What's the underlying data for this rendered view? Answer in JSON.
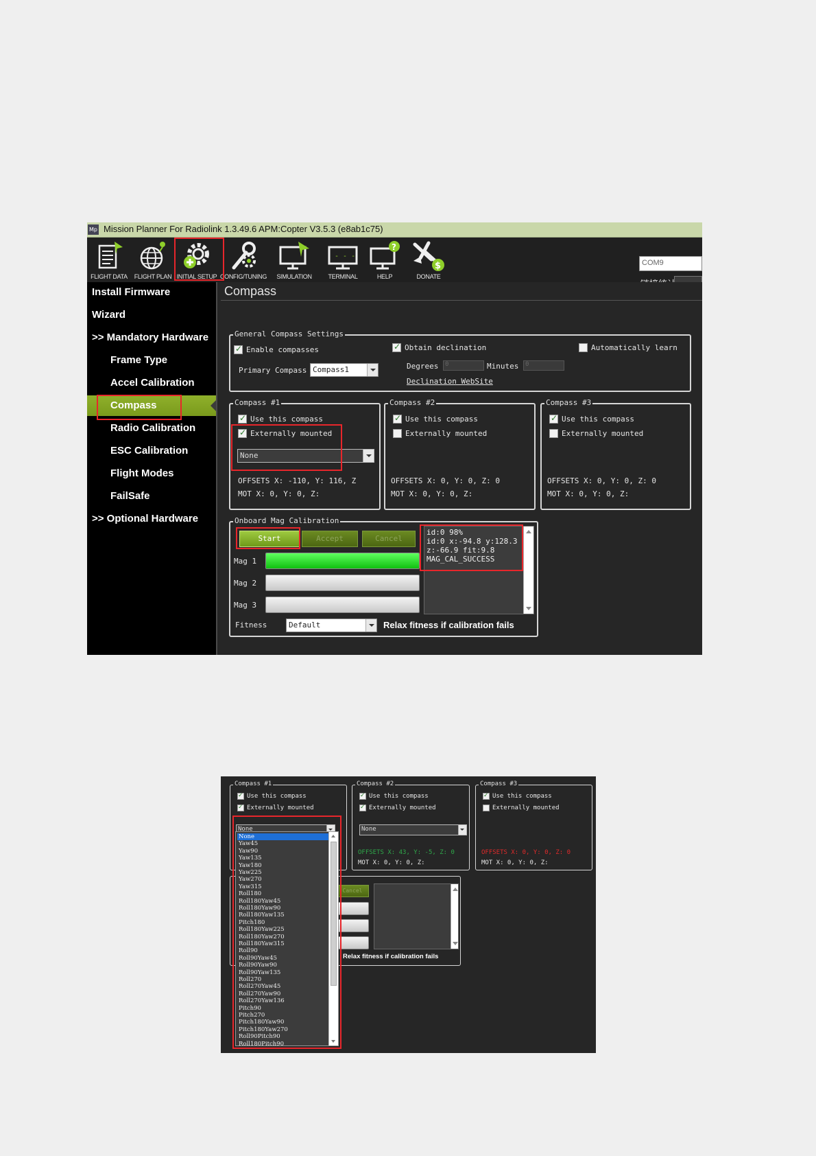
{
  "window": {
    "title": "Mission Planner For Radiolink 1.3.49.6 APM:Copter V3.5.3 (e8ab1c75)",
    "logo_text": "Mp"
  },
  "toolbar": {
    "items": [
      {
        "label": "FLIGHT DATA",
        "icon": "flight-data-icon"
      },
      {
        "label": "FLIGHT PLAN",
        "icon": "flight-plan-icon"
      },
      {
        "label": "INITIAL SETUP",
        "icon": "initial-setup-icon"
      },
      {
        "label": "CONFIG/TUNING",
        "icon": "config-tuning-icon"
      },
      {
        "label": "SIMULATION",
        "icon": "simulation-icon"
      },
      {
        "label": "TERMINAL",
        "icon": "terminal-icon"
      },
      {
        "label": "HELP",
        "icon": "help-icon"
      },
      {
        "label": "DONATE",
        "icon": "donate-icon"
      }
    ],
    "com_port": "COM9",
    "link_stats_label": "链接统计"
  },
  "sidebar": {
    "items": [
      {
        "label": "Install Firmware"
      },
      {
        "label": "Wizard"
      },
      {
        "label": ">> Mandatory Hardware"
      },
      {
        "label": "Frame Type"
      },
      {
        "label": "Accel Calibration"
      },
      {
        "label": "Compass"
      },
      {
        "label": "Radio Calibration"
      },
      {
        "label": "ESC Calibration"
      },
      {
        "label": "Flight Modes"
      },
      {
        "label": "FailSafe"
      },
      {
        "label": ">> Optional Hardware"
      }
    ],
    "active": "Compass"
  },
  "page": {
    "title": "Compass"
  },
  "general": {
    "title": "General Compass Settings",
    "enable_compasses": "Enable compasses",
    "primary_compass_label": "Primary Compass",
    "primary_compass_value": "Compass1",
    "obtain_declination": "Obtain declination",
    "automatically_learn": "Automatically learn",
    "degrees_label": "Degrees",
    "degrees_value": "0",
    "minutes_label": "Minutes",
    "minutes_value": "0",
    "declination_link": "Declination WebSite"
  },
  "compasses": [
    {
      "title": "Compass #1",
      "use_label": "Use this compass",
      "ext_label": "Externally mounted",
      "orientation": "None",
      "offsets_line": "OFFSETS  X: -110,   Y: 116,   Z",
      "mot_line": "MOT         X: 0,   Y: 0,   Z:"
    },
    {
      "title": "Compass #2",
      "use_label": "Use this compass",
      "ext_label": "Externally mounted",
      "offsets_line": "OFFSETS  X: 0,    Y: 0,    Z: 0",
      "mot_line": "MOT          X: 0,   Y: 0,   Z:"
    },
    {
      "title": "Compass #3",
      "use_label": "Use this compass",
      "ext_label": "Externally mounted",
      "offsets_line": "OFFSETS  X: 0,    Y: 0,    Z: 0",
      "mot_line": "MOT          X: 0,   Y: 0,   Z:"
    }
  ],
  "onboard": {
    "title": "Onboard Mag Calibration",
    "start_label": "Start",
    "accept_label": "Accept",
    "cancel_label": "Cancel",
    "mag1_label": "Mag 1",
    "mag2_label": "Mag 2",
    "mag3_label": "Mag 3",
    "mag1_progress": 1.0,
    "mag2_progress": 0.0,
    "mag3_progress": 0.0,
    "log_lines": [
      "id:0 98%",
      "id:0 x:-94.8 y:128.3",
      "z:-66.9 fit:9.8",
      "MAG_CAL_SUCCESS"
    ],
    "fitness_label": "Fitness",
    "fitness_value": "Default",
    "relax_label": "Relax fitness if calibration fails"
  },
  "detail": {
    "compass1_title": "Compass #1",
    "compass2_title": "Compass #2",
    "compass3_title": "Compass #3",
    "use_label": "Use this compass",
    "ext_label": "Externally mounted",
    "compass1_orientation": "None",
    "compass2_orientation": "None",
    "c2_offsets": "OFFSETS  X: 43,   Y: -5,   Z: 0",
    "c2_mot": "MOT         X: 0,   Y: 0,   Z:",
    "c3_offsets": "OFFSETS  X: 0,   Y: 0,   Z: 0",
    "c3_mot": "MOT         X: 0,   Y: 0,   Z:",
    "cancel_label": "Cancel",
    "relax_label": "Relax fitness if calibration fails",
    "offsets_green": "#2fa84a",
    "offsets_red": "#e02a2a",
    "options": [
      "None",
      "Yaw45",
      "Yaw90",
      "Yaw135",
      "Yaw180",
      "Yaw225",
      "Yaw270",
      "Yaw315",
      "Roll180",
      "Roll180Yaw45",
      "Roll180Yaw90",
      "Roll180Yaw135",
      "Pitch180",
      "Roll180Yaw225",
      "Roll180Yaw270",
      "Roll180Yaw315",
      "Roll90",
      "Roll90Yaw45",
      "Roll90Yaw90",
      "Roll90Yaw135",
      "Roll270",
      "Roll270Yaw45",
      "Roll270Yaw90",
      "Roll270Yaw136",
      "Pitch90",
      "Pitch270",
      "Pitch180Yaw90",
      "Pitch180Yaw270",
      "Roll90Pitch90",
      "Roll180Pitch90"
    ],
    "selected_option": "None"
  },
  "colors": {
    "highlight": "#e8262b",
    "accent_green": "#8fb02b",
    "background": "#262626"
  }
}
